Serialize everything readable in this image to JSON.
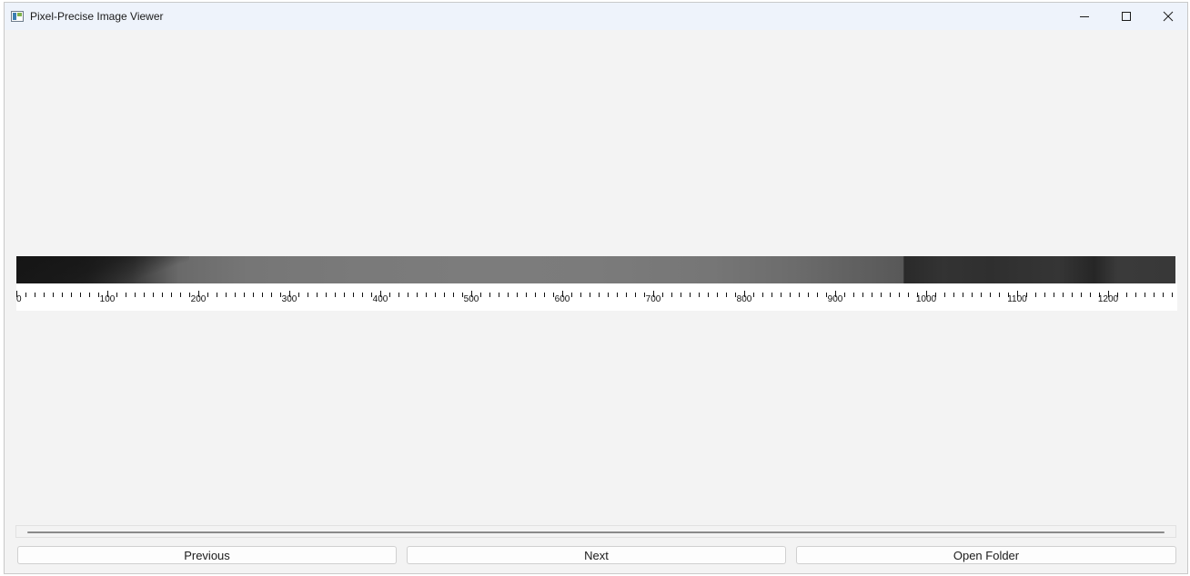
{
  "window": {
    "title": "Pixel-Precise Image Viewer"
  },
  "ruler": {
    "labels": [
      "0",
      "100",
      "200",
      "300",
      "400",
      "500",
      "600",
      "700",
      "800",
      "900",
      "1000",
      "1100",
      "1200"
    ]
  },
  "buttons": {
    "previous": "Previous",
    "next": "Next",
    "open_folder": "Open Folder"
  },
  "icons": {
    "app": "image-viewer-icon",
    "minimize": "minimize-icon",
    "maximize": "maximize-icon",
    "close": "close-icon"
  }
}
